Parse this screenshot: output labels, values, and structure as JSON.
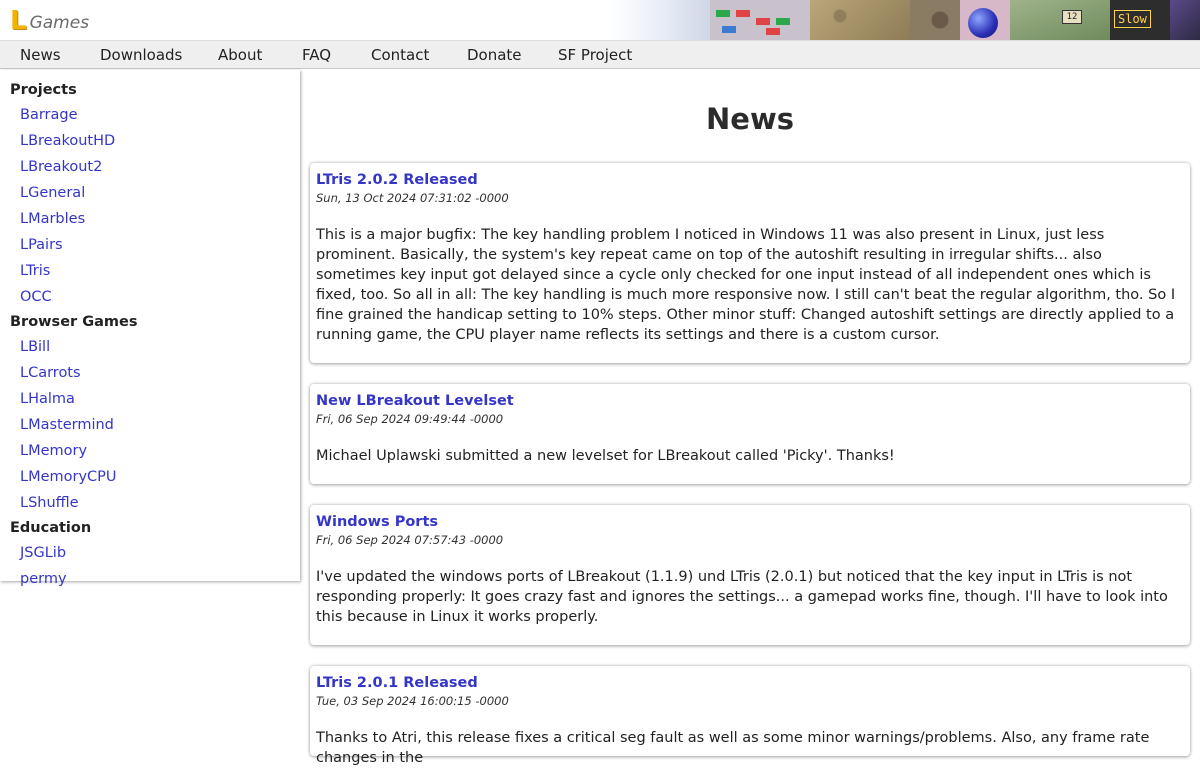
{
  "header": {
    "logo_letter": "L",
    "logo_text": "Games",
    "banner_text": [
      "12",
      "Slow"
    ]
  },
  "nav": {
    "items": [
      {
        "label": "News"
      },
      {
        "label": "Downloads"
      },
      {
        "label": "About"
      },
      {
        "label": "FAQ"
      },
      {
        "label": "Contact"
      },
      {
        "label": "Donate"
      },
      {
        "label": "SF Project"
      }
    ]
  },
  "sidebar": {
    "sections": [
      {
        "title": "Projects",
        "items": [
          "Barrage",
          "LBreakoutHD",
          "LBreakout2",
          "LGeneral",
          "LMarbles",
          "LPairs",
          "LTris",
          "OCC"
        ]
      },
      {
        "title": "Browser Games",
        "items": [
          "LBill",
          "LCarrots",
          "LHalma",
          "LMastermind",
          "LMemory",
          "LMemoryCPU",
          "LShuffle"
        ]
      },
      {
        "title": "Education",
        "items": [
          "JSGLib",
          "permy"
        ]
      }
    ]
  },
  "main": {
    "title": "News",
    "posts": [
      {
        "title": "LTris 2.0.2 Released",
        "date": "Sun, 13 Oct 2024 07:31:02 -0000",
        "body": "This is a major bugfix: The key handling problem I noticed in Windows 11 was also present in Linux, just less prominent. Basically, the system's key repeat came on top of the autoshift resulting in irregular shifts... also sometimes key input got delayed since a cycle only checked for one input instead of all independent ones which is fixed, too. So all in all: The key handling is much more responsive now. I still can't beat the regular algorithm, tho. So I fine grained the handicap setting to 10% steps. Other minor stuff: Changed autoshift settings are directly applied to a running game, the CPU player name reflects its settings and there is a custom cursor."
      },
      {
        "title": "New LBreakout Levelset",
        "date": "Fri, 06 Sep 2024 09:49:44 -0000",
        "body": "Michael Uplawski submitted a new levelset for LBreakout called 'Picky'. Thanks!"
      },
      {
        "title": "Windows Ports",
        "date": "Fri, 06 Sep 2024 07:57:43 -0000",
        "body": "I've updated the windows ports of LBreakout (1.1.9) und LTris (2.0.1) but noticed that the key input in LTris is not responding properly: It goes crazy fast and ignores the settings... a gamepad works fine, though. I'll have to look into this because in Linux it works properly."
      },
      {
        "title": "LTris 2.0.1 Released",
        "date": "Tue, 03 Sep 2024 16:00:15 -0000",
        "body": "Thanks to Atri, this release fixes a critical seg fault as well as some minor warnings/problems. Also, any frame rate changes in the"
      }
    ]
  }
}
